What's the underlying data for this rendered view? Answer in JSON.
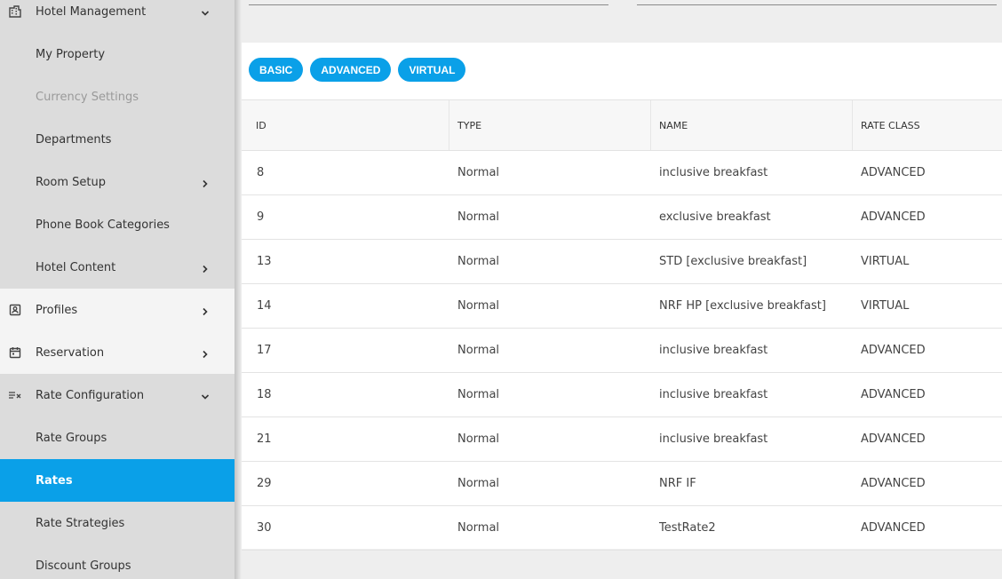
{
  "sidebar": {
    "items": [
      {
        "label": "Hotel Management",
        "icon": "building-icon",
        "chevron": "down"
      },
      {
        "label": "My Property"
      },
      {
        "label": "Currency Settings",
        "disabled": true
      },
      {
        "label": "Departments"
      },
      {
        "label": "Room Setup",
        "chevron": "right"
      },
      {
        "label": "Phone Book Categories"
      },
      {
        "label": "Hotel Content",
        "chevron": "right"
      },
      {
        "label": "Profiles",
        "icon": "profile-badge-icon",
        "chevron": "right"
      },
      {
        "label": "Reservation",
        "icon": "calendar-icon",
        "chevron": "right"
      },
      {
        "label": "Rate Configuration",
        "icon": "rate-list-icon",
        "chevron": "down"
      },
      {
        "label": "Rate Groups"
      },
      {
        "label": "Rates",
        "active": true
      },
      {
        "label": "Rate Strategies"
      },
      {
        "label": "Discount Groups"
      }
    ]
  },
  "tabs": {
    "basic": "BASIC",
    "advanced": "ADVANCED",
    "virtual": "VIRTUAL"
  },
  "table": {
    "headers": {
      "id": "ID",
      "type": "TYPE",
      "name": "NAME",
      "rate_class": "RATE CLASS"
    },
    "rows": [
      {
        "id": "8",
        "type": "Normal",
        "name": "inclusive breakfast",
        "rate_class": "ADVANCED"
      },
      {
        "id": "9",
        "type": "Normal",
        "name": "exclusive breakfast",
        "rate_class": "ADVANCED"
      },
      {
        "id": "13",
        "type": "Normal",
        "name": "STD [exclusive breakfast]",
        "rate_class": "VIRTUAL"
      },
      {
        "id": "14",
        "type": "Normal",
        "name": "NRF HP [exclusive breakfast]",
        "rate_class": "VIRTUAL"
      },
      {
        "id": "17",
        "type": "Normal",
        "name": "inclusive breakfast",
        "rate_class": "ADVANCED"
      },
      {
        "id": "18",
        "type": "Normal",
        "name": "inclusive breakfast",
        "rate_class": "ADVANCED"
      },
      {
        "id": "21",
        "type": "Normal",
        "name": "inclusive breakfast",
        "rate_class": "ADVANCED"
      },
      {
        "id": "29",
        "type": "Normal",
        "name": "NRF IF",
        "rate_class": "ADVANCED"
      },
      {
        "id": "30",
        "type": "Normal",
        "name": "TestRate2",
        "rate_class": "ADVANCED"
      }
    ]
  },
  "colors": {
    "accent": "#0aa0e8",
    "sidebar_bg": "#dcdcdc"
  }
}
